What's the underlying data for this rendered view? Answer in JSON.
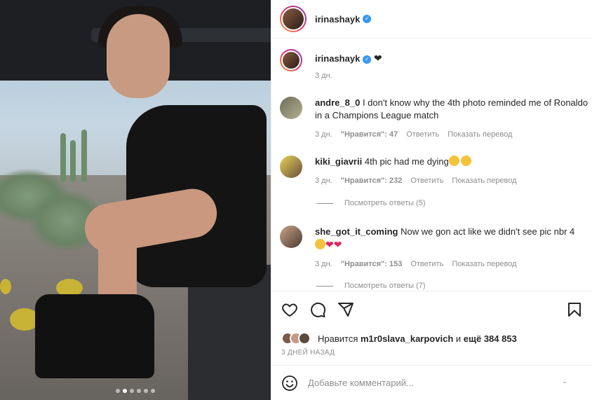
{
  "header": {
    "username": "irinashayk"
  },
  "caption": {
    "username": "irinashayk",
    "time": "3 дн."
  },
  "comments": [
    {
      "username": "andre_8_0",
      "text": "I don't know why the 4th photo reminded me of Ronaldo in a Champions League match",
      "time": "3 дн.",
      "likes": "\"Нравится\": 47",
      "reply": "Ответить",
      "translate": "Показать перевод"
    },
    {
      "username": "kiki_giavrii",
      "text": "4th pic had me dying",
      "time": "3 дн.",
      "likes": "\"Нравится\": 232",
      "reply": "Ответить",
      "translate": "Показать перевод",
      "view_replies": "Посмотреть ответы (5)"
    },
    {
      "username": "she_got_it_coming",
      "text": "Now we gon act like we didn't see pic nbr 4",
      "time": "3 дн.",
      "likes": "\"Нравится\": 153",
      "reply": "Ответить",
      "translate": "Показать перевод",
      "view_replies": "Посмотреть ответы (7)"
    }
  ],
  "likes": {
    "prefix": "Нравится",
    "user": "m1r0slava_karpovich",
    "middle": "и",
    "rest": "ещё 384 853"
  },
  "post_time": "3 ДНЕЙ НАЗАД",
  "comment_input": {
    "placeholder": "Добавьте комментарий..."
  },
  "carousel": {
    "count": 6,
    "active": 1
  },
  "colors": {
    "verified": "#3897f0",
    "heart": "#e0245e",
    "muted": "#8e8e8e"
  }
}
